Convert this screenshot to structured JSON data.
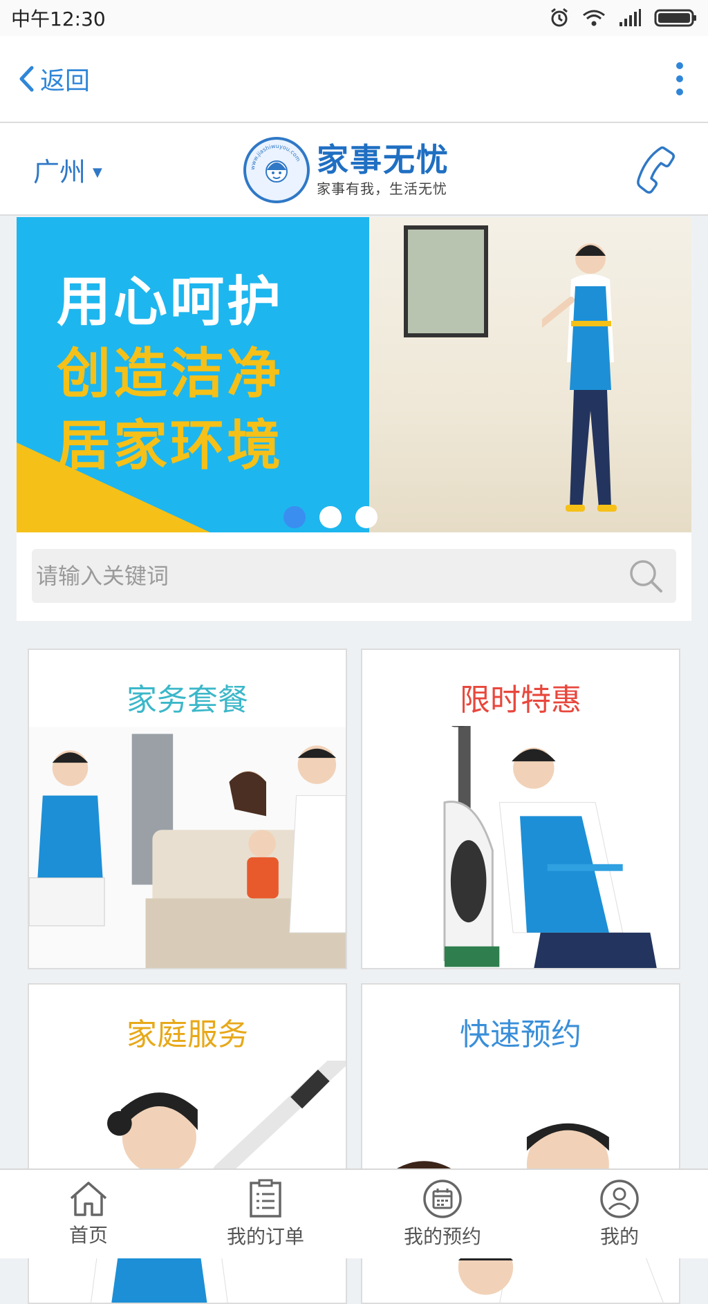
{
  "status_bar": {
    "time": "中午12:30"
  },
  "nav": {
    "back_label": "返回"
  },
  "header": {
    "city": "广州",
    "logo_title": "家事无忧",
    "logo_slogan": "家事有我，生活无忧",
    "logo_ring_text": "www.jiashiwuyou.com"
  },
  "banner": {
    "lines": [
      "用心呵护",
      "创造洁净",
      "居家环境"
    ],
    "line_colors": [
      "#ffffff",
      "#f5c018",
      "#f5c018"
    ],
    "slide_count": 3,
    "active_slide": 1
  },
  "search": {
    "placeholder": "请输入关键词"
  },
  "tiles": [
    {
      "title": "家务套餐",
      "color": "#3bb7c9"
    },
    {
      "title": "限时特惠",
      "color": "#e8473c"
    },
    {
      "title": "家庭服务",
      "color": "#e7a91a"
    },
    {
      "title": "快速预约",
      "color": "#3a8fd9"
    }
  ],
  "tabs": [
    {
      "label": "首页",
      "icon": "home-icon"
    },
    {
      "label": "我的订单",
      "icon": "order-list-icon"
    },
    {
      "label": "我的预约",
      "icon": "calendar-icon"
    },
    {
      "label": "我的",
      "icon": "user-icon"
    }
  ],
  "colors": {
    "accent": "#2f86d8",
    "banner_blue": "#1eb6ee",
    "banner_yellow": "#f5c018"
  }
}
